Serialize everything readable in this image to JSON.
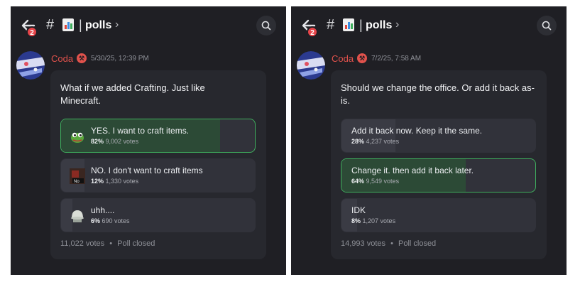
{
  "panels": [
    {
      "header": {
        "badge": "2",
        "hash": "#",
        "separator": "|",
        "channel": "polls",
        "chevron": "›"
      },
      "message": {
        "author": "Coda",
        "role_icon": "⚒",
        "timestamp": "5/30/25, 12:39 PM",
        "poll": {
          "question": "What if we added Crafting. Just like Minecraft.",
          "options": [
            {
              "label": "YES. I want to craft items.",
              "percent": "82%",
              "votes": "9,002 votes",
              "share": 0.82,
              "selected": true,
              "icon": "pepe-icon"
            },
            {
              "label": "NO. I don't want to craft items",
              "percent": "12%",
              "votes": "1,330 votes",
              "share": 0.12,
              "selected": false,
              "icon": "no-sign-icon"
            },
            {
              "label": "uhh....",
              "percent": "6%",
              "votes": "690 votes",
              "share": 0.06,
              "selected": false,
              "icon": "helmet-icon"
            }
          ],
          "total": "11,022 votes",
          "dot": "•",
          "status": "Poll closed"
        }
      }
    },
    {
      "header": {
        "badge": "2",
        "hash": "#",
        "separator": "|",
        "channel": "polls",
        "chevron": "›"
      },
      "message": {
        "author": "Coda",
        "role_icon": "⚒",
        "timestamp": "7/2/25, 7:58 AM",
        "poll": {
          "question": "Should we change the office. Or add it back as-is.",
          "options": [
            {
              "label": "Add it back now. Keep it the same.",
              "percent": "28%",
              "votes": "4,237 votes",
              "share": 0.28,
              "selected": false,
              "icon": ""
            },
            {
              "label": "Change it. then add it back later.",
              "percent": "64%",
              "votes": "9,549 votes",
              "share": 0.64,
              "selected": true,
              "icon": ""
            },
            {
              "label": "IDK",
              "percent": "8%",
              "votes": "1,207 votes",
              "share": 0.08,
              "selected": false,
              "icon": ""
            }
          ],
          "total": "14,993 votes",
          "dot": "•",
          "status": "Poll closed"
        }
      }
    }
  ],
  "colors": {
    "background": "#1f1f24",
    "card": "#27282e",
    "author": "#e1524c",
    "selected_border": "#3fae5d",
    "badge": "#e8454a"
  }
}
